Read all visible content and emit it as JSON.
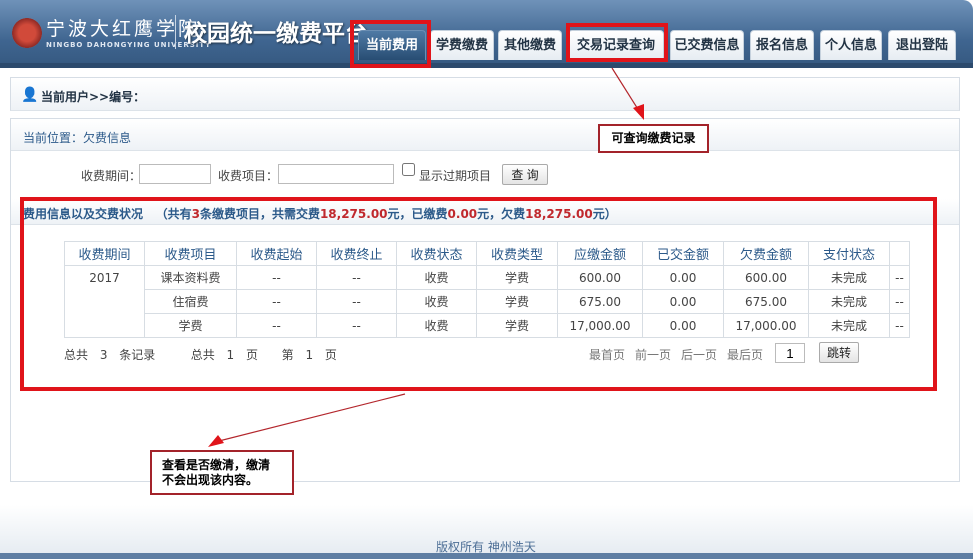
{
  "header": {
    "school_cn": "宁波大红鹰学院",
    "school_en": "NINGBO DAHONGYING UNIVERSITY",
    "platform": "校园统一缴费平台",
    "tabs": [
      {
        "label": "当前费用",
        "active": true
      },
      {
        "label": "学费缴费"
      },
      {
        "label": "其他缴费"
      },
      {
        "label": "交易记录查询"
      },
      {
        "label": "已交费信息"
      },
      {
        "label": "报名信息"
      },
      {
        "label": "个人信息"
      },
      {
        "label": "退出登陆"
      }
    ]
  },
  "user_bar": {
    "icon": "user-icon",
    "text": "当前用户>>编号："
  },
  "location": "当前位置：欠费信息",
  "filters": {
    "period_label": "收费期间：",
    "period_value": "",
    "item_label": "收费项目：",
    "item_value": "",
    "show_expired_label": "显示过期项目",
    "show_expired_checked": false,
    "query_button": "查 询"
  },
  "summary": {
    "title": "费用信息以及交费状况",
    "p1": "（共有",
    "count": "3",
    "p2": "条缴费项目，共需交费",
    "total": "18,275.00",
    "p3": "元，已缴费",
    "paid": "0.00",
    "p4": "元，欠费",
    "owed": "18,275.00",
    "p5": "元）"
  },
  "table": {
    "columns": [
      "收费期间",
      "收费项目",
      "收费起始",
      "收费终止",
      "收费状态",
      "收费类型",
      "应缴金额",
      "已交金额",
      "欠费金额",
      "支付状态",
      ""
    ],
    "period": "2017",
    "rows": [
      [
        "课本资料费",
        "--",
        "--",
        "收费",
        "学费",
        "600.00",
        "0.00",
        "600.00",
        "未完成",
        "--"
      ],
      [
        "住宿费",
        "--",
        "--",
        "收费",
        "学费",
        "675.00",
        "0.00",
        "675.00",
        "未完成",
        "--"
      ],
      [
        "学费",
        "--",
        "--",
        "收费",
        "学费",
        "17,000.00",
        "0.00",
        "17,000.00",
        "未完成",
        "--"
      ]
    ]
  },
  "pagination": {
    "total_records": "总共 3 条记录",
    "total_pages": "总共 1 页",
    "current_page": "第 1 页",
    "first": "最首页",
    "prev": "前一页",
    "next": "后一页",
    "last": "最后页",
    "page_input": "1",
    "jump": "跳转"
  },
  "annotations": {
    "callout_records": "可查询缴费记录",
    "callout_paid": "查看是否缴清，缴清\n不会出现该内容。",
    "highlight_color": "#e0141a"
  },
  "footer": "版权所有 神州浩天"
}
